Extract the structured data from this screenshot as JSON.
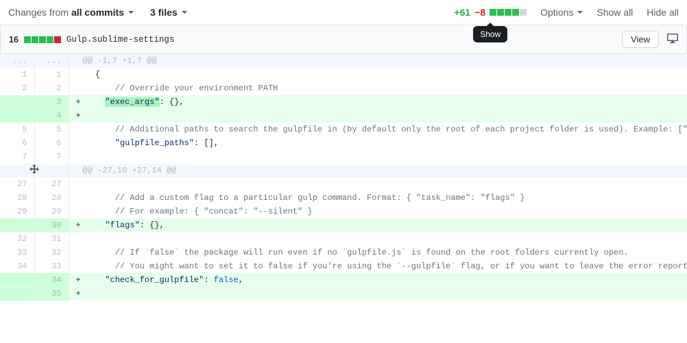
{
  "toolbar": {
    "changes_from_prefix": "Changes from",
    "changes_from_bold": "all commits",
    "files_label": "3 files",
    "plus": "+61",
    "minus": "−8",
    "tooltip": "Show",
    "options": "Options",
    "show_all": "Show all",
    "hide_all": "Hide all"
  },
  "file": {
    "count": "16",
    "name": "Gulp.sublime-settings",
    "view": "View"
  },
  "rows": [
    {
      "type": "hunk",
      "l": "...",
      "r": "...",
      "text": "@@ -1,7 +1,7 @@"
    },
    {
      "type": "ctx",
      "l": "1",
      "r": "1",
      "text": "  {"
    },
    {
      "type": "ctx",
      "l": "2",
      "r": "2",
      "text": "      // Override your environment PATH",
      "cls": "cmt"
    },
    {
      "type": "add",
      "l": "",
      "r": "3",
      "pre": "    ",
      "hl": "\"exec_args\"",
      "post": ": {},"
    },
    {
      "type": "add",
      "l": "",
      "r": "4",
      "text": ""
    },
    {
      "type": "ctx",
      "l": "5",
      "r": "5",
      "text": "      // Additional paths to search the gulpfile in (by default only the root of each project folder is used). Example: [\"src\", \"nest",
      "cls": "cmt"
    },
    {
      "type": "ctx",
      "l": "6",
      "r": "6",
      "code": "      <span class=\"str\">\"gulpfile_paths\"</span>: [],"
    },
    {
      "type": "ctx",
      "l": "7",
      "r": "7",
      "text": ""
    },
    {
      "type": "hunk",
      "expand": true,
      "text": "@@ -27,10 +27,14 @@"
    },
    {
      "type": "ctx",
      "l": "27",
      "r": "27",
      "text": ""
    },
    {
      "type": "ctx",
      "l": "28",
      "r": "28",
      "text": "      // Add a custom flag to a particular gulp command. Format: { \"task_name\": \"flags\" }",
      "cls": "cmt"
    },
    {
      "type": "ctx",
      "l": "29",
      "r": "29",
      "text": "      // For example: { \"concat\": \"--silent\" }",
      "cls": "cmt"
    },
    {
      "type": "add",
      "l": "",
      "r": "30",
      "code": "    <span class=\"str\">\"flags\"</span>: {},"
    },
    {
      "type": "ctx",
      "l": "32",
      "r": "31",
      "text": ""
    },
    {
      "type": "ctx",
      "l": "33",
      "r": "32",
      "text": "      // If `false` the package will run even if no `gulpfile.js` is found on the root folders currently open.",
      "cls": "cmt"
    },
    {
      "type": "ctx",
      "l": "34",
      "r": "33",
      "text": "      // You might want to set it to false if you're using the `--gulpfile` flag, or if you want to leave the error reporting to gulp",
      "cls": "cmt"
    },
    {
      "type": "add",
      "l": "",
      "r": "34",
      "code": "    <span class=\"str\">\"check_for_gulpfile\"</span>: <span class=\"kw\">false</span>,"
    },
    {
      "type": "add",
      "l": "",
      "r": "35",
      "text": ""
    }
  ]
}
